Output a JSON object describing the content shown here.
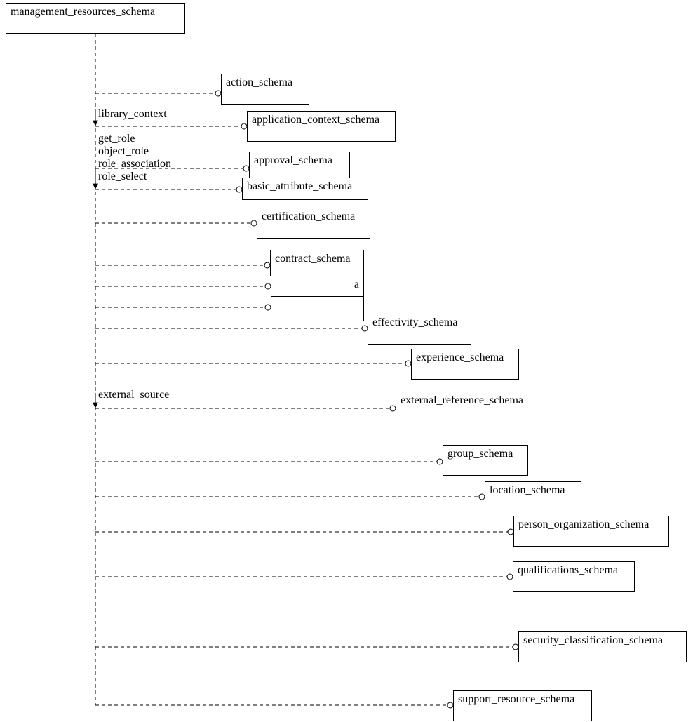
{
  "root": {
    "label": "management_resources_schema"
  },
  "annotations": {
    "library_context": "library_context",
    "get_role": "get_role",
    "object_role": "object_role",
    "role_association": "role_association",
    "role_select": "role_select",
    "external_source": "external_source"
  },
  "schemas": {
    "action": "action_schema",
    "application_context": "application_context_schema",
    "approval": "approval_schema",
    "basic_attribute": "basic_attribute_schema",
    "certification": "certification_schema",
    "contract": "contract_schema",
    "hidden_a": "a",
    "effectivity": "effectivity_schema",
    "experience": "experience_schema",
    "external_reference": "external_reference_schema",
    "group": "group_schema",
    "location": "location_schema",
    "person_organization": "person_organization_schema",
    "qualifications": "qualifications_schema",
    "security_classification": "security_classification_schema",
    "support_resource": "support_resource_schema"
  }
}
